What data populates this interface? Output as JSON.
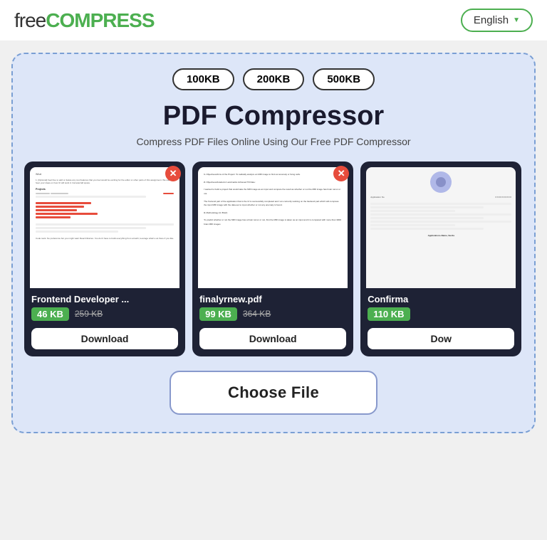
{
  "header": {
    "logo_free": "free",
    "logo_compress": "COMPRESS",
    "lang_label": "English",
    "lang_chevron": "▼"
  },
  "size_presets": {
    "label_100": "100KB",
    "label_200": "200KB",
    "label_500": "500KB"
  },
  "compressor": {
    "title": "PDF Compressor",
    "subtitle": "Compress PDF Files Online Using Our Free PDF Compressor"
  },
  "files": [
    {
      "name": "Frontend Developer ...",
      "compressed_size": "46 KB",
      "original_size": "259 KB",
      "download_label": "Download"
    },
    {
      "name": "finalyrnew.pdf",
      "compressed_size": "99 KB",
      "original_size": "364 KB",
      "download_label": "Download"
    },
    {
      "name": "Confirma",
      "compressed_size": "110 KB",
      "original_size": "",
      "download_label": "Dow"
    }
  ],
  "choose_file": {
    "label": "Choose File"
  }
}
